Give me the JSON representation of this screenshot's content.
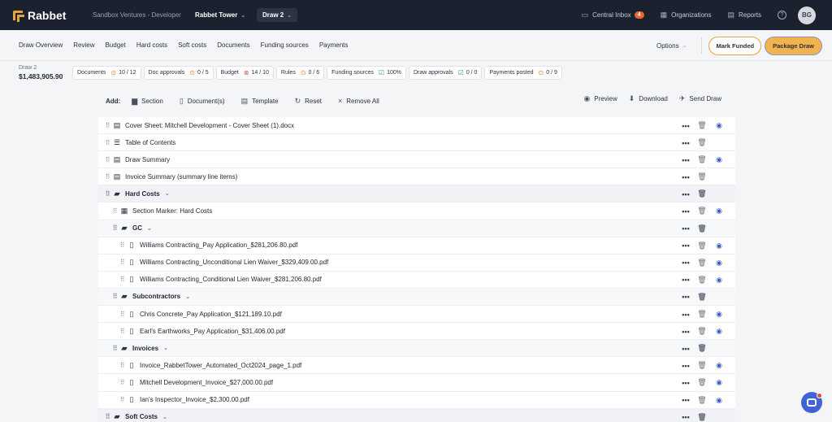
{
  "header": {
    "logo_text": "Rabbet",
    "workspace": "Sandbox Ventures - Developer",
    "project": "Rabbet Tower",
    "draw": "Draw 2",
    "inbox_label": "Central Inbox",
    "inbox_count": "4",
    "organizations_label": "Organizations",
    "reports_label": "Reports",
    "help_glyph": "?",
    "avatar_initials": "BG"
  },
  "nav": {
    "tabs": [
      "Draw Overview",
      "Review",
      "Budget",
      "Hard costs",
      "Soft costs",
      "Documents",
      "Funding sources",
      "Payments"
    ],
    "options_label": "Options",
    "mark_funded_label": "Mark Funded",
    "package_draw_label": "Package Draw"
  },
  "stats": {
    "draw_label": "Draw 2",
    "draw_amount": "$1,483,905.90",
    "items": [
      {
        "label": "Documents",
        "value": "10 / 12",
        "status": "warn"
      },
      {
        "label": "Doc approvals",
        "value": "0 / 5",
        "status": "warn"
      },
      {
        "label": "Budget",
        "value": "14 / 10",
        "status": "err"
      },
      {
        "label": "Rules",
        "value": "0 / 6",
        "status": "warn"
      },
      {
        "label": "Funding sources",
        "value": "100%",
        "status": "ok"
      },
      {
        "label": "Draw approvals",
        "value": "0 / 0",
        "status": "ok"
      },
      {
        "label": "Payments posted",
        "value": "0 / 9",
        "status": "warn"
      }
    ]
  },
  "toolbar": {
    "add_label": "Add:",
    "section_label": "Section",
    "documents_label": "Document(s)",
    "template_label": "Template",
    "reset_label": "Reset",
    "remove_all_label": "Remove All",
    "preview_label": "Preview",
    "download_label": "Download",
    "send_label": "Send Draw"
  },
  "rows": [
    {
      "label": "Cover Sheet: Mitchell Development - Cover Sheet (1).docx",
      "kind": "doc",
      "indent": 0,
      "icon": "cover-icon",
      "eye": true
    },
    {
      "label": "Table of Contents",
      "kind": "doc",
      "indent": 0,
      "icon": "list-icon",
      "eye": false
    },
    {
      "label": "Draw Summary",
      "kind": "doc",
      "indent": 0,
      "icon": "cover-icon",
      "eye": true
    },
    {
      "label": "Invoice Summary (summary line items)",
      "kind": "doc",
      "indent": 0,
      "icon": "cover-icon",
      "eye": false
    },
    {
      "label": "Hard Costs",
      "kind": "section",
      "indent": 0,
      "icon": "folder-icon",
      "eye": false
    },
    {
      "label": "Section Marker: Hard Costs",
      "kind": "doc",
      "indent": 1,
      "icon": "marker-icon",
      "eye": true
    },
    {
      "label": "GC",
      "kind": "sub",
      "indent": 1,
      "icon": "folder-icon",
      "eye": false
    },
    {
      "label": "Williams Contracting_Pay Application_$281,206.80.pdf",
      "kind": "doc",
      "indent": 2,
      "icon": "file-icon",
      "eye": true
    },
    {
      "label": "Williams Contracting_Unconditional Lien Waiver_$329,409.00.pdf",
      "kind": "doc",
      "indent": 2,
      "icon": "file-icon",
      "eye": true
    },
    {
      "label": "Williams Contracting_Conditional Lien Waiver_$281,206.80.pdf",
      "kind": "doc",
      "indent": 2,
      "icon": "file-icon",
      "eye": true
    },
    {
      "label": "Subcontractors",
      "kind": "sub",
      "indent": 1,
      "icon": "folder-icon",
      "eye": false
    },
    {
      "label": "Chris Concrete_Pay Application_$121,189.10.pdf",
      "kind": "doc",
      "indent": 2,
      "icon": "file-icon",
      "eye": true
    },
    {
      "label": "Earl's Earthworks_Pay Application_$31,406.00.pdf",
      "kind": "doc",
      "indent": 2,
      "icon": "file-icon",
      "eye": true
    },
    {
      "label": "Invoices",
      "kind": "sub",
      "indent": 1,
      "icon": "folder-icon",
      "eye": false
    },
    {
      "label": "Invoice_RabbetTower_Automated_Oct2024_page_1.pdf",
      "kind": "doc",
      "indent": 2,
      "icon": "file-icon",
      "eye": true
    },
    {
      "label": "Mitchell Development_Invoice_$27,000.00.pdf",
      "kind": "doc",
      "indent": 2,
      "icon": "file-icon",
      "eye": true
    },
    {
      "label": "Ian's Inspector_Invoice_$2,300.00.pdf",
      "kind": "doc",
      "indent": 2,
      "icon": "file-icon",
      "eye": true
    },
    {
      "label": "Soft Costs",
      "kind": "section",
      "indent": 0,
      "icon": "folder-icon",
      "eye": false
    }
  ],
  "colors": {
    "topbar": "#1c2130",
    "accent": "#f2b24d",
    "link": "#3f5fc5",
    "chat": "#4263d5"
  }
}
